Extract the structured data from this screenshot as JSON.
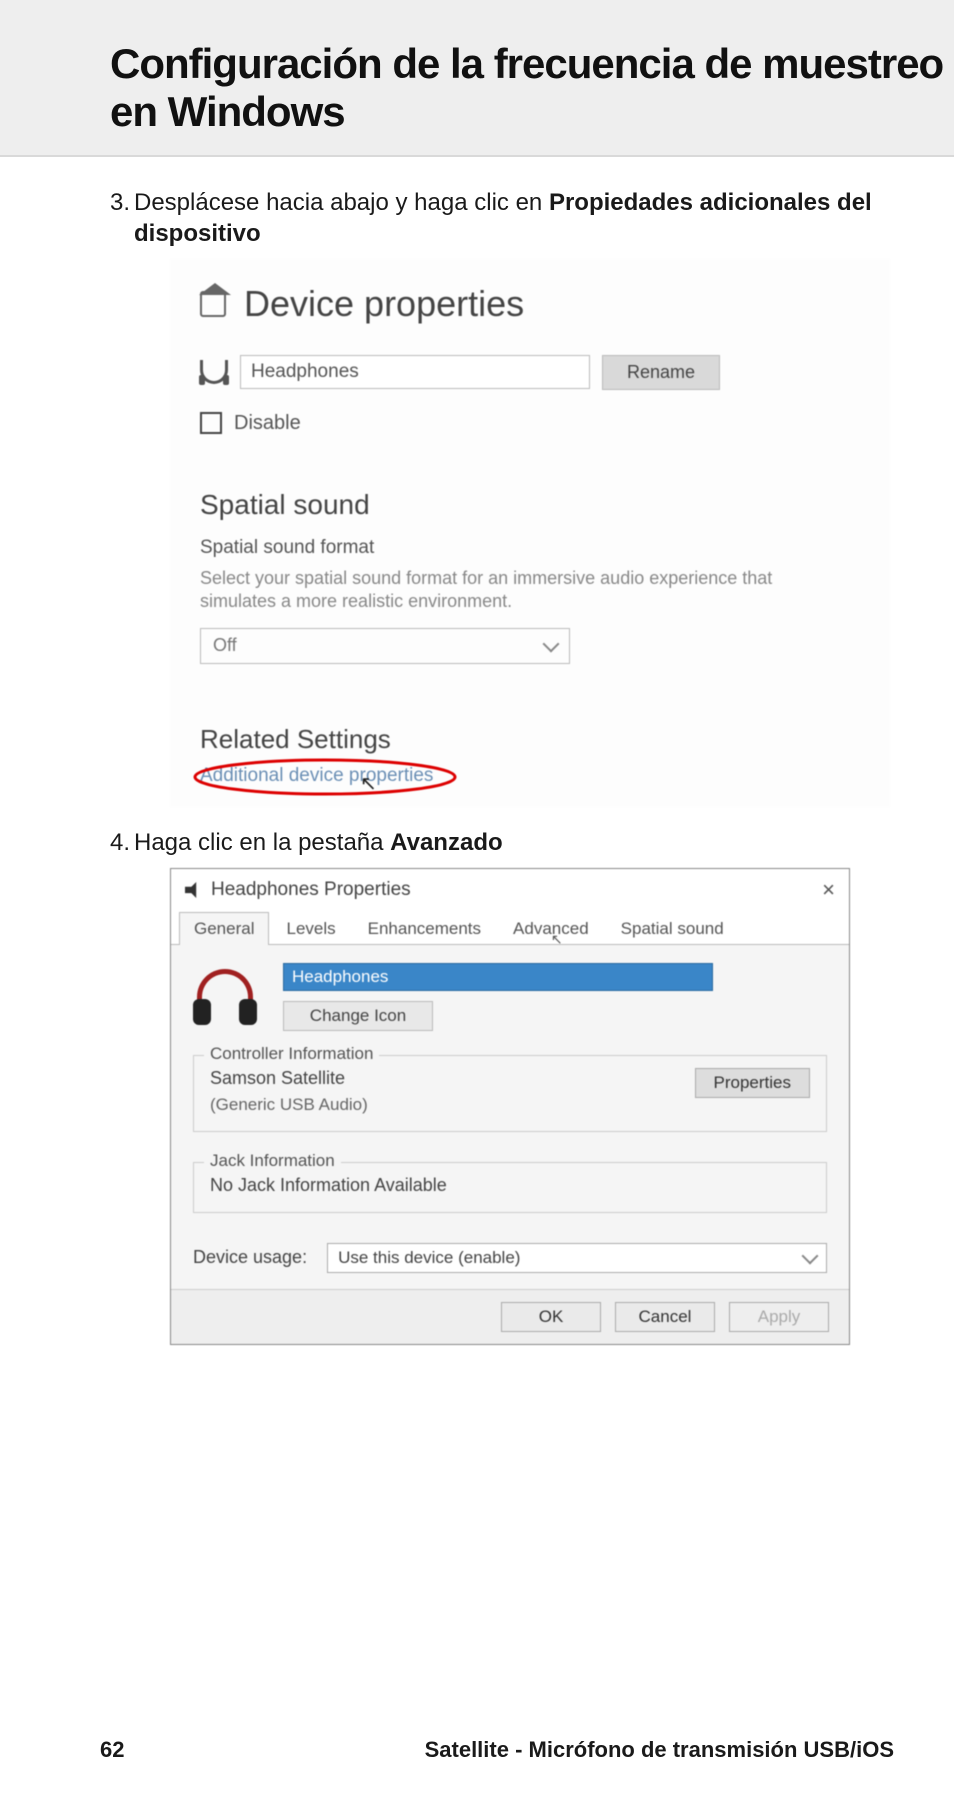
{
  "page": {
    "title": "Configuración de la frecuencia de muestreo en Windows",
    "number": "62",
    "footer": "Satellite - Micrófono de transmisión USB/iOS"
  },
  "steps": {
    "s3_num": "3.",
    "s3_a": "Desplácese hacia abajo y haga clic en ",
    "s3_b": "Propiedades adicionales del dispositivo",
    "s4_num": "4.",
    "s4_a": "Haga clic en la pestaña ",
    "s4_b": "Avanzado"
  },
  "shot1": {
    "title": "Device properties",
    "device_name": "Headphones",
    "rename": "Rename",
    "disable": "Disable",
    "spatial_title": "Spatial sound",
    "spatial_sub": "Spatial sound format",
    "spatial_desc": "Select your spatial sound format for an immersive audio experience that simulates a more realistic environment.",
    "spatial_value": "Off",
    "related_title": "Related Settings",
    "link": "Additional device properties"
  },
  "shot2": {
    "title": "Headphones Properties",
    "tabs": {
      "general": "General",
      "levels": "Levels",
      "enh": "Enhancements",
      "adv": "Advanced",
      "spatial": "Spatial sound"
    },
    "name_value": "Headphones",
    "change_icon": "Change Icon",
    "ctrl_legend": "Controller Information",
    "ctrl_name": "Samson Satellite",
    "ctrl_sub": "(Generic USB Audio)",
    "properties": "Properties",
    "jack_legend": "Jack Information",
    "jack_text": "No Jack Information Available",
    "usage_label": "Device usage:",
    "usage_value": "Use this device (enable)",
    "ok": "OK",
    "cancel": "Cancel",
    "apply": "Apply"
  }
}
